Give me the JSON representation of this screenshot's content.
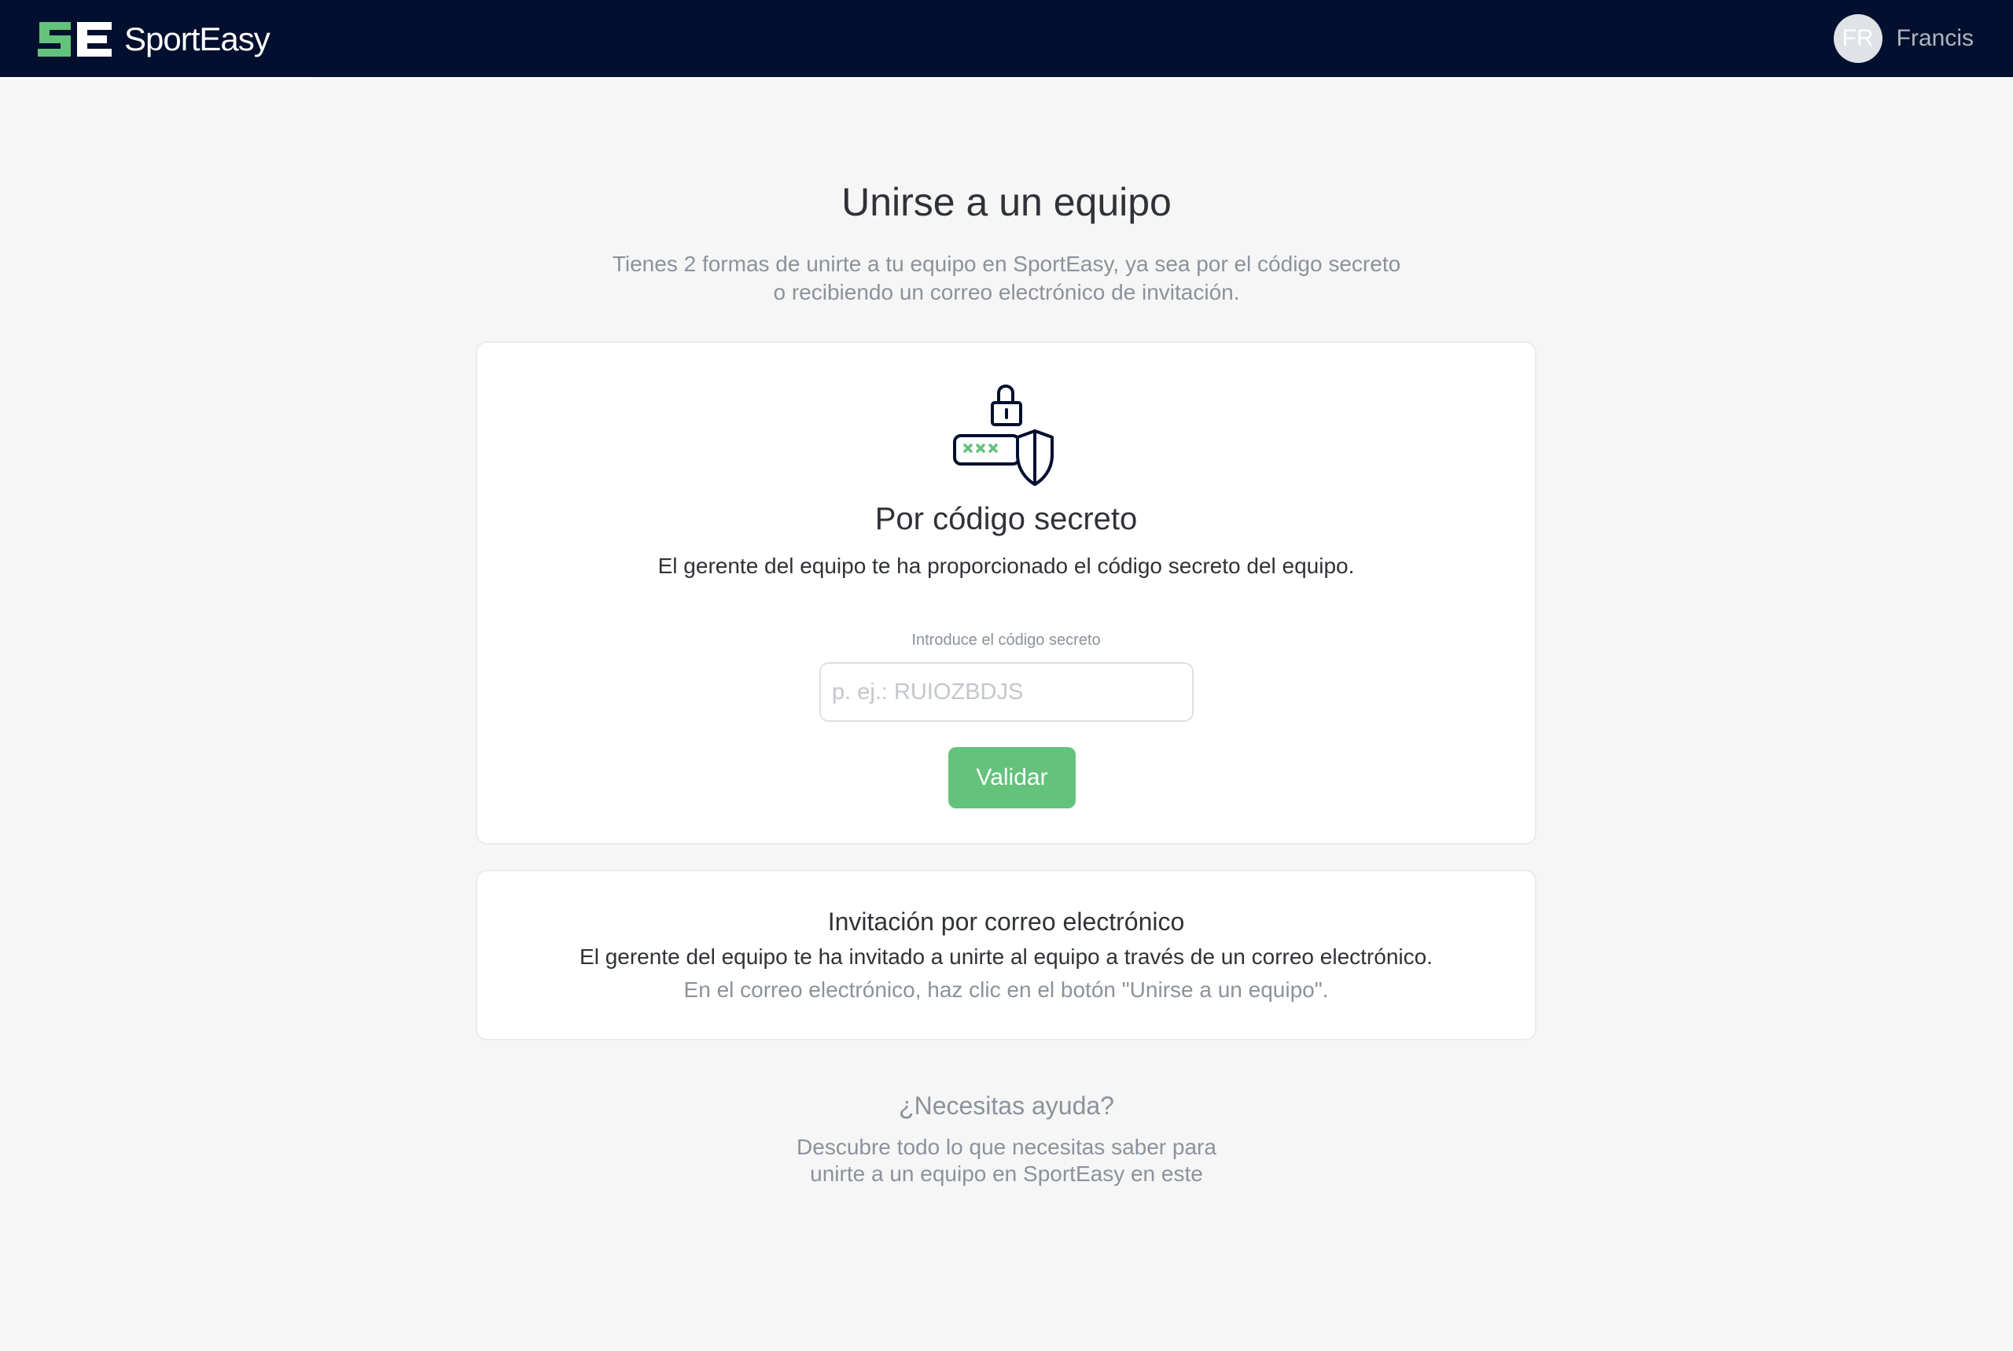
{
  "header": {
    "brand": "SportEasy",
    "user": {
      "initials": "FR",
      "name": "Francis"
    }
  },
  "page": {
    "title": "Unirse a un equipo",
    "subtitle_line1": "Tienes 2 formas de unirte a tu equipo en SportEasy, ya sea por el código secreto",
    "subtitle_line2": "o recibiendo un correo electrónico de invitación."
  },
  "secret_code": {
    "illustration": "lock-code-shield-icon",
    "title": "Por código secreto",
    "description": "El gerente del equipo te ha proporcionado el código secreto del equipo.",
    "input_label": "Introduce el código secreto",
    "input_placeholder": "p. ej.: RUIOZBDJS",
    "input_value": "",
    "button_label": "Validar"
  },
  "email_invitation": {
    "title": "Invitación por correo electrónico",
    "description": "El gerente del equipo te ha invitado a unirte al equipo a través de un correo electrónico.",
    "hint": "En el correo electrónico, haz clic en el botón \"Unirse a un equipo\"."
  },
  "help": {
    "title": "¿Necesitas ayuda?",
    "text_line1": "Descubre todo lo que necesitas saber para",
    "text_line2": "unirte a un equipo en SportEasy en este"
  },
  "colors": {
    "header_bg": "#030f2e",
    "brand_green": "#63c27b",
    "page_bg": "#f6f6f6",
    "text_dark": "#2f3236",
    "text_muted": "#8b929b"
  }
}
